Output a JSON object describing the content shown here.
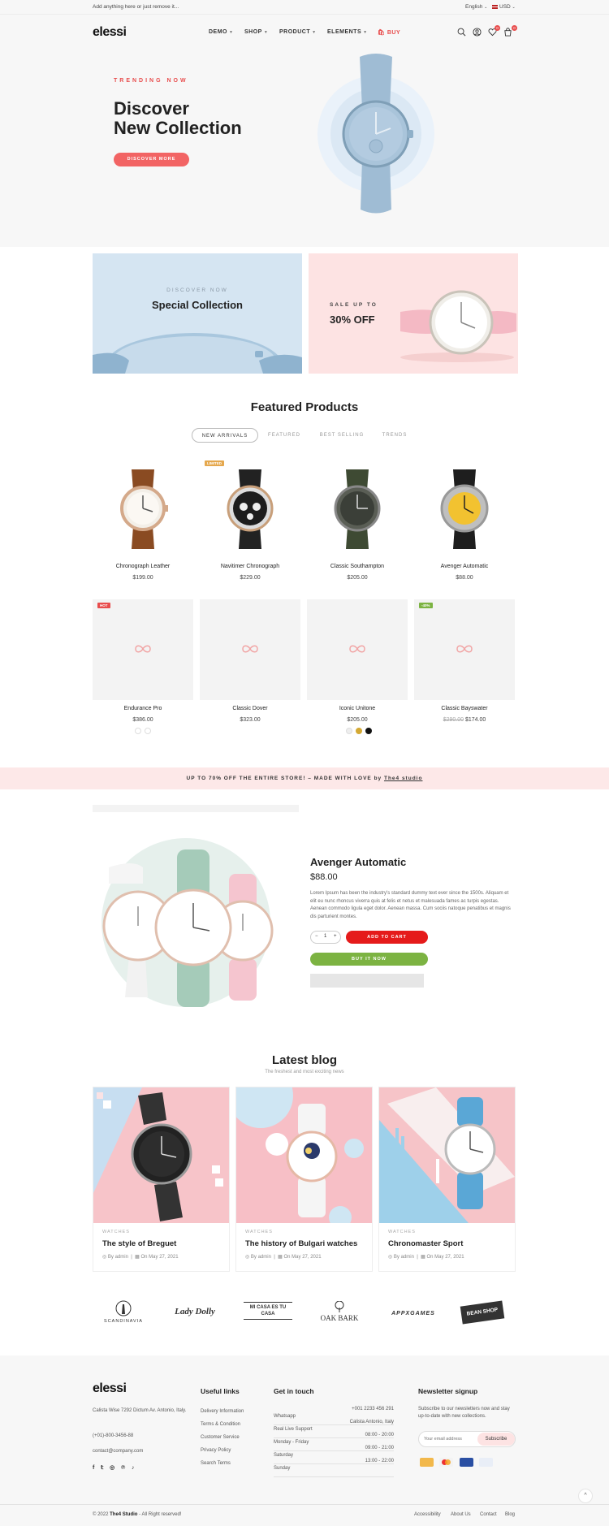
{
  "topbar": {
    "message": "Add anything here or just remove it...",
    "language": "English",
    "currency": "USD"
  },
  "header": {
    "logo": "elessi",
    "nav": [
      {
        "label": "DEMO"
      },
      {
        "label": "SHOP"
      },
      {
        "label": "PRODUCT"
      },
      {
        "label": "ELEMENTS"
      }
    ],
    "buy_label": "BUY",
    "wishlist_count": "0",
    "cart_count": "0"
  },
  "hero": {
    "eyebrow": "TRENDING NOW",
    "title_line1": "Discover",
    "title_line2": "New Collection",
    "button": "DISCOVER MORE"
  },
  "banners": {
    "left_eyebrow": "DISCOVER NOW",
    "left_title": "Special Collection",
    "right_eyebrow": "SALE UP TO",
    "right_title": "30% OFF"
  },
  "featured": {
    "title": "Featured Products",
    "tabs": [
      "NEW ARRIVALS",
      "FEATURED",
      "BEST SELLING",
      "TRENDS"
    ],
    "products_row1": [
      {
        "name": "Chronograph Leather",
        "price": "$199.00"
      },
      {
        "name": "Navitimer Chronograph",
        "price": "$229.00",
        "tag": "LIMITED"
      },
      {
        "name": "Classic Southampton",
        "price": "$205.00"
      },
      {
        "name": "Avenger Automatic",
        "price": "$88.00"
      }
    ],
    "products_row2": [
      {
        "name": "Endurance Pro",
        "price": "$386.00",
        "tag": "HOT"
      },
      {
        "name": "Classic Dover",
        "price": "$323.00"
      },
      {
        "name": "Iconic Unitone",
        "price": "$205.00"
      },
      {
        "name": "Classic Bayswater",
        "old_price": "$290.00",
        "price": "$174.00",
        "tag": "-40%"
      }
    ]
  },
  "promo": {
    "text": "UP TO 70% OFF THE ENTIRE STORE! – MADE WITH LOVE by",
    "link": "The4 studio"
  },
  "deal": {
    "title": "Avenger Automatic",
    "price": "$88.00",
    "description": "Lorem Ipsum has been the industry's standard dummy text ever since the 1500s. Aliquam et elit eu nunc rhoncus viverra quis at felis et netus et malesuada fames ac turpis egestas. Aenean commodo ligula eget dolor. Aenean massa. Cum sociis natoque penatibus et magnis dis parturient montes.",
    "qty": "1",
    "add_to_cart": "ADD TO CART",
    "buy_now": "BUY IT NOW",
    "minus": "−",
    "plus": "+"
  },
  "blog": {
    "title": "Latest blog",
    "subtitle": "The freshest and most exciting news",
    "posts": [
      {
        "category": "WATCHES",
        "title": "The style of Breguet",
        "author": "By admin",
        "date": "On May 27, 2021"
      },
      {
        "category": "WATCHES",
        "title": "The history of Bulgari watches",
        "author": "By admin",
        "date": "On May 27, 2021"
      },
      {
        "category": "WATCHES",
        "title": "Chronomaster Sport",
        "author": "By admin",
        "date": "On May 27, 2021"
      }
    ]
  },
  "brands": [
    "SCANDINAVIA",
    "Lady Dolly",
    "MI CASA ES TU CASA",
    "OAK BARK",
    "APPXGAMES",
    "BEAN SHOP"
  ],
  "footer": {
    "logo": "elessi",
    "address": "Calista Wise 7292 Dictum Av. Antonio, Italy.",
    "phone": "(+01)-800-3456-88",
    "email": "contact@company.com",
    "useful_title": "Useful links",
    "useful_links": [
      "Delivery Information",
      "Terms & Condition",
      "Customer Service",
      "Privacy Policy",
      "Search Terms"
    ],
    "contact_title": "Get in touch",
    "contact_rows": [
      {
        "label": "Whatsapp",
        "value": "+001 2233 456 291"
      },
      {
        "label": "Real Live Support",
        "value": "Calista Antonio, Italy"
      },
      {
        "label": "Monday - Friday",
        "value": "08:00 - 20:00"
      },
      {
        "label": "Saturday",
        "value": "09:00 - 21:00"
      },
      {
        "label": "Sunday",
        "value": "13:00 - 22:00"
      }
    ],
    "newsletter_title": "Newsletter signup",
    "newsletter_text": "Subscribe to our newsletters now and stay up-to-date with new collections.",
    "email_placeholder": "Your email address",
    "subscribe": "Subscribe",
    "copyright_prefix": "© 2022",
    "copyright_brand": "The4 Studio",
    "copyright_suffix": "- All Right reserved!",
    "bottom_links": [
      "Accessibility",
      "About Us",
      "Contact",
      "Blog"
    ]
  },
  "colors": {
    "accent": "#e84c4c",
    "green": "#7cb342",
    "pink_bg": "#fde8e8",
    "blue_bg": "#d5e5f2"
  }
}
